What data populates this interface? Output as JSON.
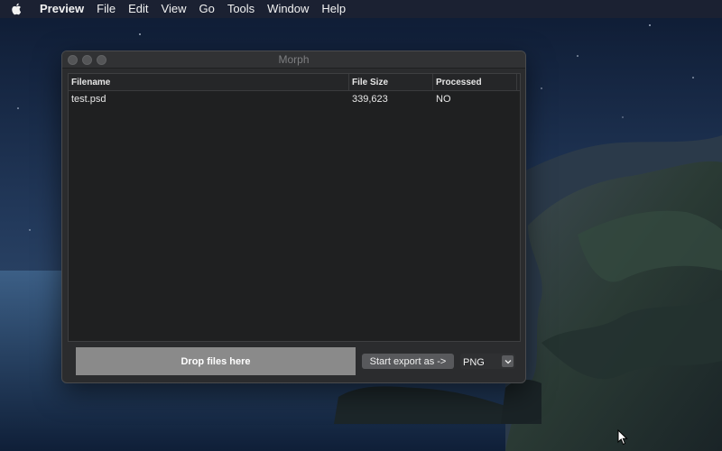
{
  "menubar": {
    "apple_icon": "apple-logo-icon",
    "app_name": "Preview",
    "items": [
      "File",
      "Edit",
      "View",
      "Go",
      "Tools",
      "Window",
      "Help"
    ]
  },
  "window": {
    "title": "Morph",
    "table": {
      "columns": [
        "Filename",
        "File Size",
        "Processed"
      ],
      "rows": [
        {
          "filename": "test.psd",
          "size": "339,623",
          "processed": "NO"
        }
      ]
    },
    "drop_zone_label": "Drop files here",
    "export_button_label": "Start export as ->",
    "format_select": {
      "value": "PNG"
    }
  },
  "colors": {
    "window_bg": "#2b2c2e",
    "table_bg": "#1f2021",
    "drop_zone_bg": "#8a8a8a",
    "menubar_bg": "#1c2232"
  }
}
